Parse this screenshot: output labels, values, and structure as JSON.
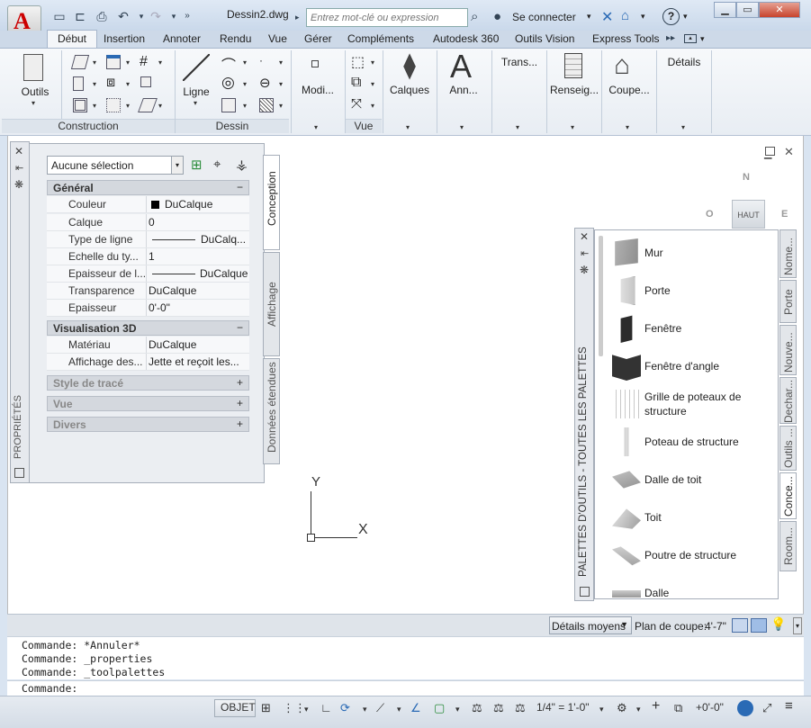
{
  "app": {
    "logo_letter": "A",
    "logo_caption": "A"
  },
  "titlebar": {
    "document_title": "Dessin2.dwg",
    "search_placeholder": "Entrez mot-clé ou expression",
    "signin_label": "Se connecter",
    "help_label": "?"
  },
  "tabs": [
    {
      "label": "Début",
      "active": true
    },
    {
      "label": "Insertion"
    },
    {
      "label": "Annoter"
    },
    {
      "label": "Rendu"
    },
    {
      "label": "Vue"
    },
    {
      "label": "Gérer"
    },
    {
      "label": "Compléments"
    },
    {
      "label": "Autodesk 360"
    },
    {
      "label": "Outils Vision"
    },
    {
      "label": "Express Tools"
    }
  ],
  "ribbon": {
    "outils_label": "Outils",
    "ligne_label": "Ligne",
    "modi_label": "Modi...",
    "calques_label": "Calques",
    "ann_label": "Ann...",
    "trans_label": "Trans...",
    "renseig_label": "Renseig...",
    "coupe_label": "Coupe...",
    "details_label": "Détails",
    "panel_construction": "Construction",
    "panel_dessin": "Dessin",
    "panel_vue": "Vue"
  },
  "properties": {
    "title": "PROPRIÉTÉS",
    "selection": "Aucune sélection",
    "tabs": [
      "Conception",
      "Affichage",
      "Données étendues"
    ],
    "sections": {
      "general": {
        "title": "Général",
        "toggle": "−"
      },
      "vis3d": {
        "title": "Visualisation 3D",
        "toggle": "−"
      },
      "style": {
        "title": "Style de tracé",
        "toggle": "+"
      },
      "vue": {
        "title": "Vue",
        "toggle": "+"
      },
      "divers": {
        "title": "Divers",
        "toggle": "+"
      }
    },
    "general_rows": [
      {
        "key": "Couleur",
        "value": "DuCalque"
      },
      {
        "key": "Calque",
        "value": "0"
      },
      {
        "key": "Type de ligne",
        "value": "DuCalq..."
      },
      {
        "key": "Echelle du ty...",
        "value": "1"
      },
      {
        "key": "Epaisseur de l...",
        "value": "DuCalque"
      },
      {
        "key": "Transparence",
        "value": "DuCalque"
      },
      {
        "key": "Epaisseur",
        "value": "0'-0\""
      }
    ],
    "vis3d_rows": [
      {
        "key": "Matériau",
        "value": "DuCalque"
      },
      {
        "key": "Affichage des...",
        "value": "Jette et reçoit les..."
      }
    ]
  },
  "canvas": {
    "ucs_y": "Y",
    "ucs_x": "X",
    "compass_n": "N",
    "compass_o": "O",
    "compass_e": "E",
    "viewcube_top": "HAUT"
  },
  "tool_palette": {
    "title": "PALETTES D'OUTILS - TOUTES LES PALETTES",
    "tabs": [
      "Nome...",
      "Porte",
      "Nouve...",
      "Dechar...",
      "Outils ...",
      "Conce...",
      "Room..."
    ],
    "tools": [
      "Mur",
      "Porte",
      "Fenêtre",
      "Fenêtre d'angle",
      "Grille de poteaux de structure",
      "Poteau de structure",
      "Dalle de toit",
      "Toit",
      "Poutre de structure",
      "Dalle"
    ]
  },
  "detail_bar": {
    "detail_level": "Détails moyens",
    "cut_plane_label": "Plan de coupe:",
    "cut_plane_value": "4'-7\""
  },
  "command": {
    "history": [
      "Commande: *Annuler*",
      "Commande: _properties",
      "Commande: _toolpalettes"
    ],
    "prompt": "Commande:"
  },
  "statusbar": {
    "objet": "OBJET",
    "scale": "1/4\" = 1'-0\"",
    "elevation": "+0'-0\""
  }
}
